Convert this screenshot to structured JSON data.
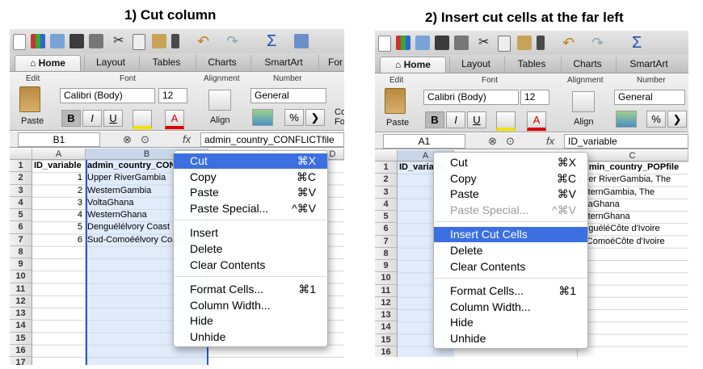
{
  "titles": {
    "left": "1) Cut column",
    "right": "2) Insert cut cells at the far left"
  },
  "ribbon": {
    "tabs": [
      "Home",
      "Layout",
      "Tables",
      "Charts",
      "SmartArt",
      "For"
    ],
    "group_edit": "Edit",
    "group_font": "Font",
    "group_alignment": "Alignment",
    "group_number": "Number",
    "paste_label": "Paste",
    "font_name": "Calibri (Body)",
    "font_size": "12",
    "number_format": "General",
    "bold": "B",
    "italic": "I",
    "underline": "U",
    "align_label": "Align",
    "percent": "%",
    "font_color_glyph": "A",
    "cond_format_label": "Co\nFo"
  },
  "left_sheet": {
    "namebox": "B1",
    "formula": "admin_country_CONFLICTfile",
    "columns": [
      "A",
      "B",
      "D"
    ],
    "rows": [
      "1",
      "2",
      "3",
      "4",
      "5",
      "6",
      "7",
      "8",
      "9",
      "10",
      "11",
      "12",
      "13",
      "14",
      "15",
      "16",
      "17"
    ],
    "colA": [
      "ID_variable",
      "1",
      "2",
      "3",
      "4",
      "5",
      "6"
    ],
    "colB": [
      "admin_country_CONFL",
      "Upper RiverGambia",
      "WesternGambia",
      "VoltaGhana",
      "WesternGhana",
      "Denguélélvory Coast",
      "Sud-Comoéélvory Coast"
    ]
  },
  "right_sheet": {
    "namebox": "A1",
    "formula": "ID_variable",
    "columns": [
      "A",
      "C"
    ],
    "rows": [
      "1",
      "2",
      "3",
      "4",
      "5",
      "6",
      "7",
      "8",
      "9",
      "10",
      "11",
      "12",
      "13",
      "14",
      "15",
      "16"
    ],
    "colA": [
      "ID_variable"
    ],
    "colC": [
      "admin_country_POPfile",
      "pper RiverGambia, The",
      "esternGambia, The",
      "oltaGhana",
      "esternGhana",
      "enguéléCôte d'Ivoire",
      "d-ComoéCôte d'Ivoire"
    ]
  },
  "left_menu": [
    {
      "label": "Cut",
      "shortcut": "⌘X"
    },
    {
      "label": "Copy",
      "shortcut": "⌘C"
    },
    {
      "label": "Paste",
      "shortcut": "⌘V"
    },
    {
      "label": "Paste Special...",
      "shortcut": "^⌘V"
    },
    {
      "label": "Insert",
      "shortcut": ""
    },
    {
      "label": "Delete",
      "shortcut": ""
    },
    {
      "label": "Clear Contents",
      "shortcut": ""
    },
    {
      "label": "Format Cells...",
      "shortcut": "⌘1"
    },
    {
      "label": "Column Width...",
      "shortcut": ""
    },
    {
      "label": "Hide",
      "shortcut": ""
    },
    {
      "label": "Unhide",
      "shortcut": ""
    }
  ],
  "right_menu": [
    {
      "label": "Cut",
      "shortcut": "⌘X"
    },
    {
      "label": "Copy",
      "shortcut": "⌘C"
    },
    {
      "label": "Paste",
      "shortcut": "⌘V"
    },
    {
      "label": "Paste Special...",
      "shortcut": "^⌘V"
    },
    {
      "label": "Insert Cut Cells",
      "shortcut": ""
    },
    {
      "label": "Delete",
      "shortcut": ""
    },
    {
      "label": "Clear Contents",
      "shortcut": ""
    },
    {
      "label": "Format Cells...",
      "shortcut": "⌘1"
    },
    {
      "label": "Column Width...",
      "shortcut": ""
    },
    {
      "label": "Hide",
      "shortcut": ""
    },
    {
      "label": "Unhide",
      "shortcut": ""
    }
  ],
  "colors": {
    "highlight": "#3c6fe0",
    "selection": "#dbe6f7",
    "cut_border": "#2a5ad8"
  },
  "icons": [
    "new-doc-icon",
    "templates-icon",
    "open-icon",
    "save-icon",
    "print-icon",
    "cut-icon",
    "copy-icon",
    "paste-icon",
    "format-brush-icon",
    "undo-icon",
    "redo-icon",
    "sum-icon",
    "home-icon",
    "paste-clipboard-icon",
    "fill-color-icon",
    "font-color-icon",
    "align-icon",
    "currency-icon"
  ]
}
